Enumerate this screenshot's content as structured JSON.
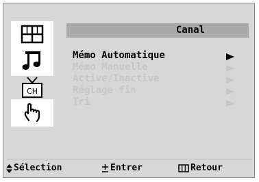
{
  "menu": {
    "title": "Canal",
    "items": [
      {
        "label": "Mémo Automatique",
        "state": "selected"
      },
      {
        "label": "Mémo Manuelle",
        "state": "disabled"
      },
      {
        "label": "Active/Inactive",
        "state": "disabled"
      },
      {
        "label": "Réglage fin",
        "state": "disabled"
      },
      {
        "label": "Tri",
        "state": "disabled"
      }
    ]
  },
  "sidebar": {
    "items": [
      {
        "icon": "picture-icon",
        "active": false
      },
      {
        "icon": "sound-icon",
        "active": false
      },
      {
        "icon": "channel-icon",
        "label": "CH",
        "active": true
      },
      {
        "icon": "setup-icon",
        "active": false
      }
    ]
  },
  "footer": {
    "select_label": "Sélection",
    "enter_label": "Entrer",
    "return_label": "Retour"
  },
  "colors": {
    "background": "#d7d7d7",
    "title_bar": "#a9a9a9",
    "disabled_text": "#c6c6c6",
    "sidebar_bg": "#ffffff"
  }
}
